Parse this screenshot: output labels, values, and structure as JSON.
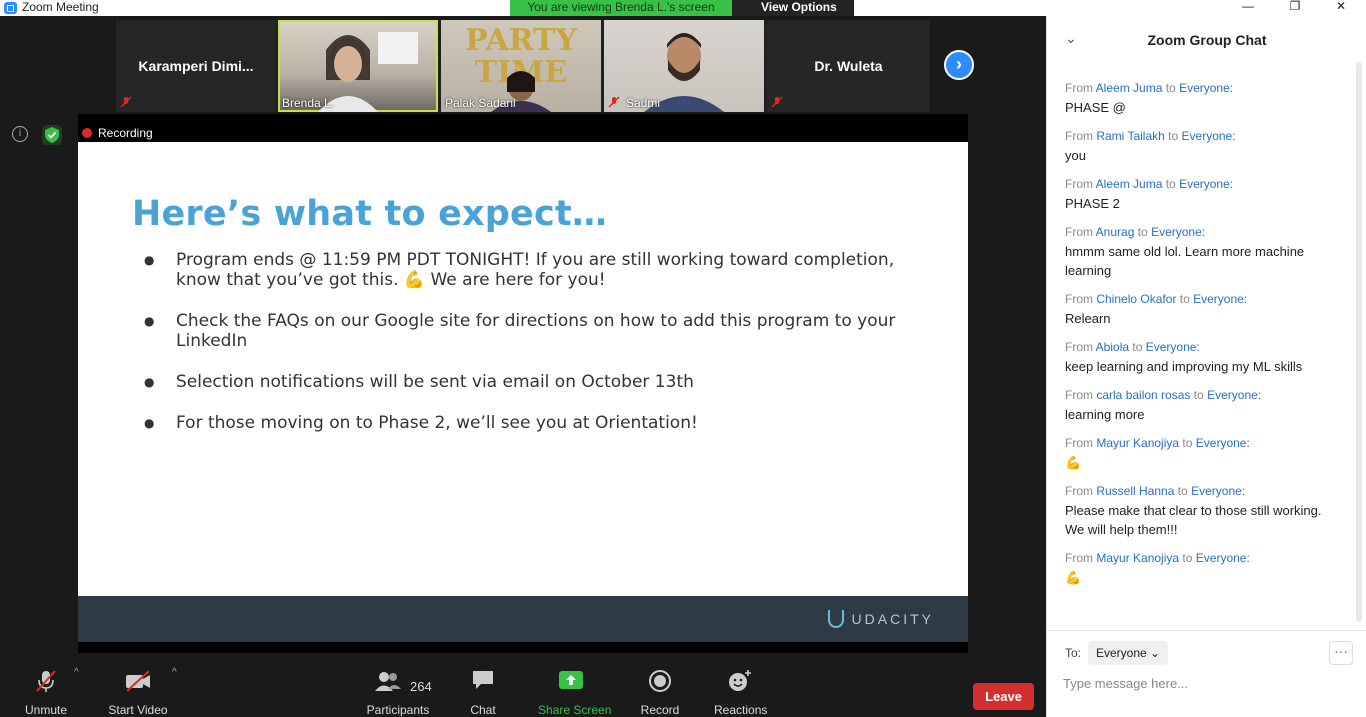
{
  "window": {
    "title": "Zoom Meeting",
    "minimize": "—",
    "restore": "❐",
    "close": "✕"
  },
  "share_banner": {
    "viewing": "You are viewing Brenda L.'s screen",
    "view_options": "View Options ⌄"
  },
  "participants_strip": [
    {
      "name": "Karamperi Dimi...",
      "muted": true,
      "video": false
    },
    {
      "name": "Brenda L.",
      "muted": false,
      "video": true,
      "active": true
    },
    {
      "name": "Palak Sadani",
      "muted": false,
      "video": true,
      "bg_text": "PARTY TIME"
    },
    {
      "name": "Sadmi",
      "muted": true,
      "video": true
    },
    {
      "name": "Dr. Wuleta",
      "muted": true,
      "video": false
    }
  ],
  "recording_label": "Recording",
  "slide": {
    "heading": "Here’s what to expect…",
    "bullets": [
      "Program ends @ 11:59 PM PDT TONIGHT! If you are still working toward completion, know that you’ve got this. 💪 We are here for you!",
      "Check the FAQs on our Google site for directions on how to add this program to your LinkedIn",
      "Selection notifications will be sent via email on October 13th",
      "For those moving on to Phase 2, we’ll see you at Orientation!"
    ],
    "brand": "UDACITY"
  },
  "toolbar": {
    "unmute": "Unmute",
    "start_video": "Start Video",
    "participants": "Participants",
    "participants_count": "264",
    "chat": "Chat",
    "share_screen": "Share Screen",
    "record": "Record",
    "reactions": "Reactions",
    "leave": "Leave"
  },
  "chat": {
    "title": "Zoom Group Chat",
    "from_word": "From",
    "to_word": "to",
    "messages": [
      {
        "from": "Aleem Juma",
        "to": "Everyone:",
        "text": "PHASE @"
      },
      {
        "from": "Rami Tailakh",
        "to": "Everyone:",
        "text": "you"
      },
      {
        "from": "Aleem Juma",
        "to": "Everyone:",
        "text": "PHASE 2"
      },
      {
        "from": "Anurag",
        "to": "Everyone:",
        "text": "hmmm same old lol. Learn more machine learning"
      },
      {
        "from": "Chinelo Okafor",
        "to": "Everyone:",
        "text": "Relearn"
      },
      {
        "from": "Abiola",
        "to": "Everyone:",
        "text": "keep learning and improving my ML skills"
      },
      {
        "from": "carla bailon rosas",
        "to": "Everyone:",
        "text": "learning more"
      },
      {
        "from": "Mayur Kanojiya",
        "to": "Everyone:",
        "text": "💪"
      },
      {
        "from": "Russell Hanna",
        "to": "Everyone:",
        "text": "Please make that clear to those still working. We will help them!!!"
      },
      {
        "from": "Mayur Kanojiya",
        "to": "Everyone:",
        "text": "💪"
      }
    ],
    "to_label": "To:",
    "recipient": "Everyone ⌄",
    "more": "···",
    "input_placeholder": "Type message here..."
  },
  "colors": {
    "accent": "#2d8cff",
    "share_green": "#39c047",
    "leave_red": "#d32f2f",
    "slide_heading": "#4aa3d6"
  }
}
